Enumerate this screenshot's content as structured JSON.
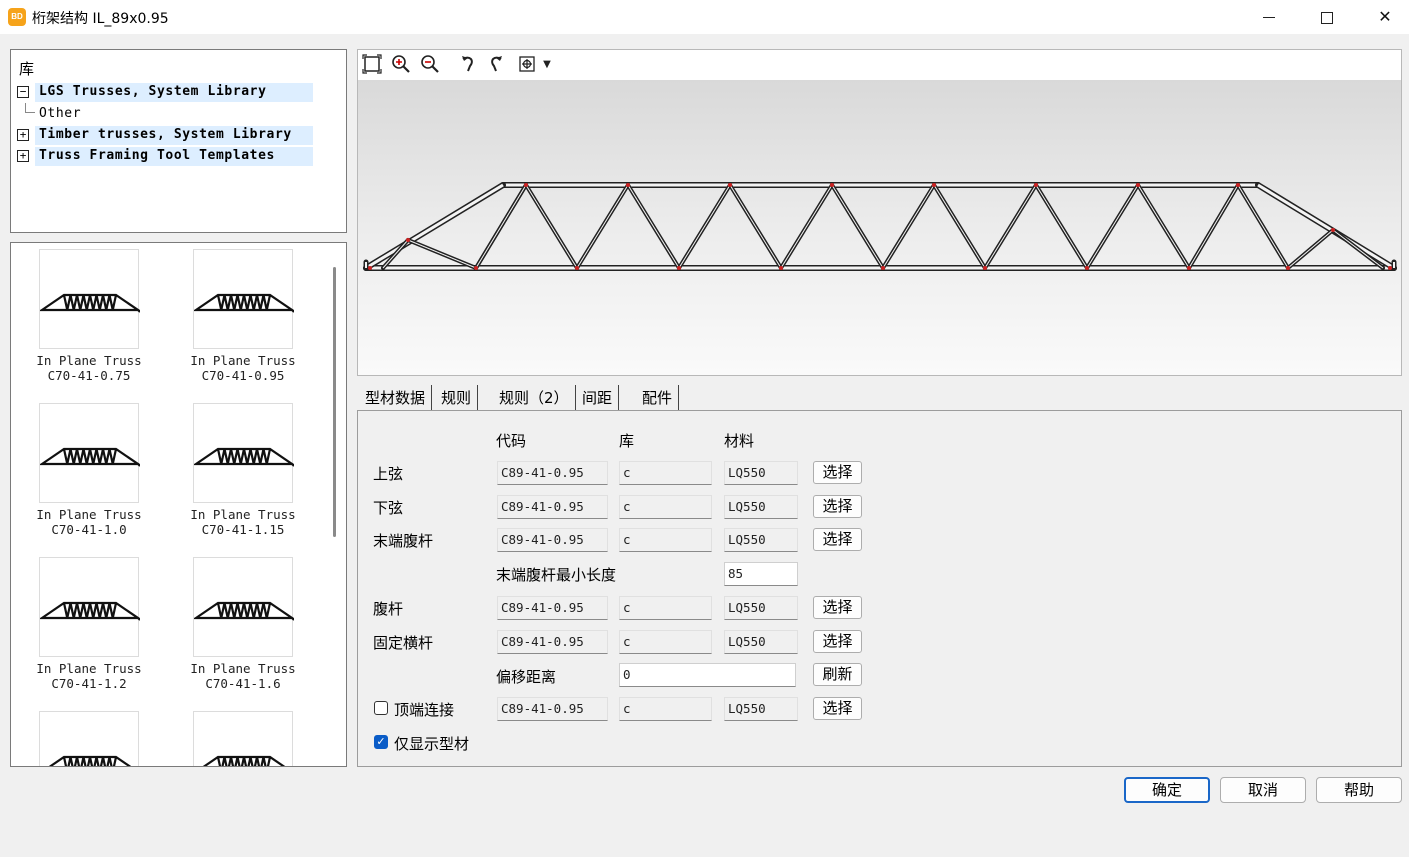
{
  "window": {
    "icon_text": "BD",
    "title": "桁架结构 IL_89x0.95"
  },
  "library": {
    "header": "库",
    "nodes": [
      {
        "label": "LGS Trusses, System Library",
        "expander": "−"
      },
      {
        "label": "Timber trusses, System Library",
        "expander": "+"
      },
      {
        "label": "Truss Framing Tool Templates",
        "expander": "+"
      }
    ],
    "child": "Other"
  },
  "thumbnails": [
    {
      "line1": "In Plane Truss",
      "line2": "C70-41-0.75"
    },
    {
      "line1": "In Plane Truss",
      "line2": "C70-41-0.95"
    },
    {
      "line1": "In Plane Truss",
      "line2": "C70-41-1.0"
    },
    {
      "line1": "In Plane Truss",
      "line2": "C70-41-1.15"
    },
    {
      "line1": "In Plane Truss",
      "line2": "C70-41-1.2"
    },
    {
      "line1": "In Plane Truss",
      "line2": "C70-41-1.6"
    },
    {
      "line1": "",
      "line2": ""
    },
    {
      "line1": "",
      "line2": ""
    }
  ],
  "tabs": [
    "型材数据",
    "规则",
    "规则（2）",
    "间距",
    "配件"
  ],
  "columns": {
    "code": "代码",
    "library": "库",
    "material": "材料"
  },
  "rows": {
    "top_chord": {
      "label": "上弦",
      "code": "C89-41-0.95",
      "lib": "c",
      "material": "LQ550",
      "button": "选择"
    },
    "bottom_chord": {
      "label": "下弦",
      "code": "C89-41-0.95",
      "lib": "c",
      "material": "LQ550",
      "button": "选择"
    },
    "end_web": {
      "label": "末端腹杆",
      "code": "C89-41-0.95",
      "lib": "c",
      "material": "LQ550",
      "button": "选择"
    },
    "end_web_min": {
      "label": "末端腹杆最小长度",
      "value": "85"
    },
    "web": {
      "label": "腹杆",
      "code": "C89-41-0.95",
      "lib": "c",
      "material": "LQ550",
      "button": "选择"
    },
    "fixed_cross": {
      "label": "固定横杆",
      "code": "C89-41-0.95",
      "lib": "c",
      "material": "LQ550",
      "button": "选择"
    },
    "offset": {
      "label": "偏移距离",
      "value": "0",
      "button": "刷新"
    },
    "top_splice": {
      "label": "顶端连接",
      "code": "C89-41-0.95",
      "lib": "c",
      "material": "LQ550",
      "button": "选择",
      "checked": false
    },
    "show_only": {
      "label": "仅显示型材",
      "checked": true
    }
  },
  "footer": {
    "ok": "确定",
    "cancel": "取消",
    "help": "帮助"
  }
}
